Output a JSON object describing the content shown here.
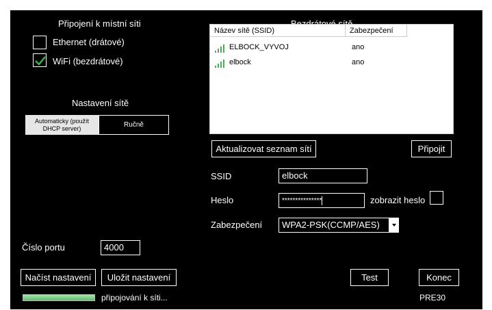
{
  "local_network": {
    "title": "Připojení k místní síti",
    "ethernet_label": "Ethernet (drátové)",
    "ethernet_checked": false,
    "wifi_label": "WiFi (bezdrátové)",
    "wifi_checked": true
  },
  "network_settings": {
    "title": "Nastavení sítě",
    "auto_label": "Automaticky (použít DHCP server)",
    "manual_label": "Ručně",
    "selected": "auto"
  },
  "wireless": {
    "title": "Bezdrátové sítě",
    "columns": [
      "Název sítě (SSID)",
      "Zabezpečení"
    ],
    "rows": [
      {
        "ssid": "ELBOCK_VYVOJ",
        "security": "ano",
        "signal": 4
      },
      {
        "ssid": "elbock",
        "security": "ano",
        "signal": 4
      }
    ],
    "refresh_label": "Aktualizovat seznam sítí",
    "connect_label": "Připojit"
  },
  "form": {
    "ssid_label": "SSID",
    "ssid_value": "elbock",
    "password_label": "Heslo",
    "password_value": "***************",
    "show_password_label": "zobrazit heslo",
    "show_password_checked": false,
    "security_label": "Zabezpečení",
    "security_value": "WPA2-PSK(CCMP/AES)"
  },
  "port": {
    "label": "Číslo portu",
    "value": "4000"
  },
  "buttons": {
    "load": "Načíst nastavení",
    "save": "Uložit nastavení",
    "test": "Test",
    "exit": "Konec"
  },
  "status": {
    "text": "připojování k síti...",
    "progress": 1.0,
    "code": "PRE30"
  },
  "colors": {
    "background": "#000000",
    "accent_green": "#3cb44b",
    "progress_green": "#5cc068",
    "auto_button_bg": "#e6e6e6"
  }
}
